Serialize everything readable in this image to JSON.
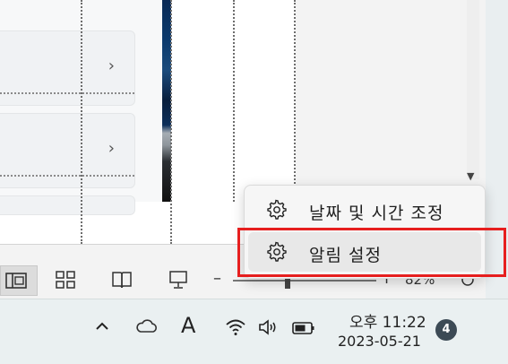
{
  "context_menu": {
    "items": [
      {
        "label": "날짜 및 시간 조정",
        "icon": "gear-icon"
      },
      {
        "label": "알림 설정",
        "icon": "gear-icon"
      }
    ]
  },
  "status_bar": {
    "zoom_minus": "–",
    "zoom_plus": "+",
    "zoom_level": "82%"
  },
  "taskbar": {
    "clock_time": "오후 11:22",
    "clock_date": "2023-05-21",
    "notification_count": "4",
    "ime_indicator": "A"
  },
  "colors": {
    "highlight": "#e61e1e",
    "badge": "#3c4a55"
  }
}
